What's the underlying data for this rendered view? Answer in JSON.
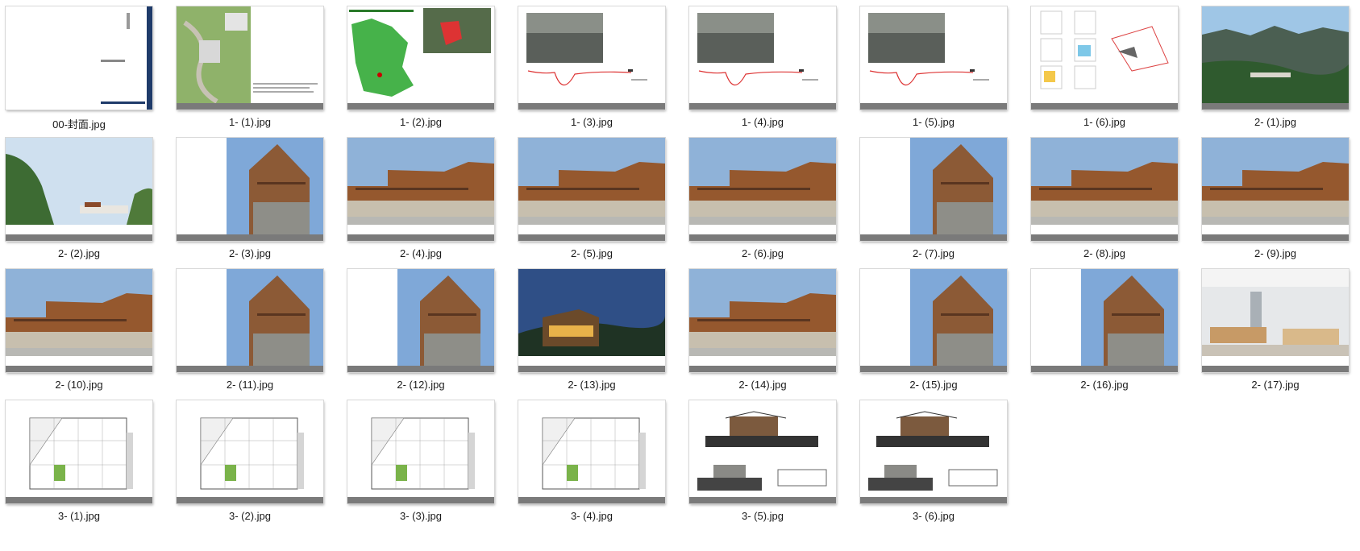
{
  "files": [
    {
      "name": "00-封面.jpg",
      "kind": "cover"
    },
    {
      "name": "1- (1).jpg",
      "kind": "siteplan"
    },
    {
      "name": "1- (2).jpg",
      "kind": "map"
    },
    {
      "name": "1- (3).jpg",
      "kind": "analysis"
    },
    {
      "name": "1- (4).jpg",
      "kind": "analysis"
    },
    {
      "name": "1- (5).jpg",
      "kind": "analysis"
    },
    {
      "name": "1- (6).jpg",
      "kind": "diagram"
    },
    {
      "name": "2- (1).jpg",
      "kind": "landscape"
    },
    {
      "name": "2- (2).jpg",
      "kind": "photo-wide"
    },
    {
      "name": "2- (3).jpg",
      "kind": "photo-right"
    },
    {
      "name": "2- (4).jpg",
      "kind": "photo-full"
    },
    {
      "name": "2- (5).jpg",
      "kind": "photo-full"
    },
    {
      "name": "2- (6).jpg",
      "kind": "photo-full"
    },
    {
      "name": "2- (7).jpg",
      "kind": "photo-right"
    },
    {
      "name": "2- (8).jpg",
      "kind": "photo-full"
    },
    {
      "name": "2- (9).jpg",
      "kind": "photo-full"
    },
    {
      "name": "2- (10).jpg",
      "kind": "photo-full"
    },
    {
      "name": "2- (11).jpg",
      "kind": "photo-right"
    },
    {
      "name": "2- (12).jpg",
      "kind": "photo-right"
    },
    {
      "name": "2- (13).jpg",
      "kind": "photo-dusk"
    },
    {
      "name": "2- (14).jpg",
      "kind": "photo-full"
    },
    {
      "name": "2- (15).jpg",
      "kind": "photo-right"
    },
    {
      "name": "2- (16).jpg",
      "kind": "photo-right"
    },
    {
      "name": "2- (17).jpg",
      "kind": "interior"
    },
    {
      "name": "3- (1).jpg",
      "kind": "plan"
    },
    {
      "name": "3- (2).jpg",
      "kind": "plan"
    },
    {
      "name": "3- (3).jpg",
      "kind": "plan"
    },
    {
      "name": "3- (4).jpg",
      "kind": "plan"
    },
    {
      "name": "3- (5).jpg",
      "kind": "elevation"
    },
    {
      "name": "3- (6).jpg",
      "kind": "elevation"
    }
  ]
}
